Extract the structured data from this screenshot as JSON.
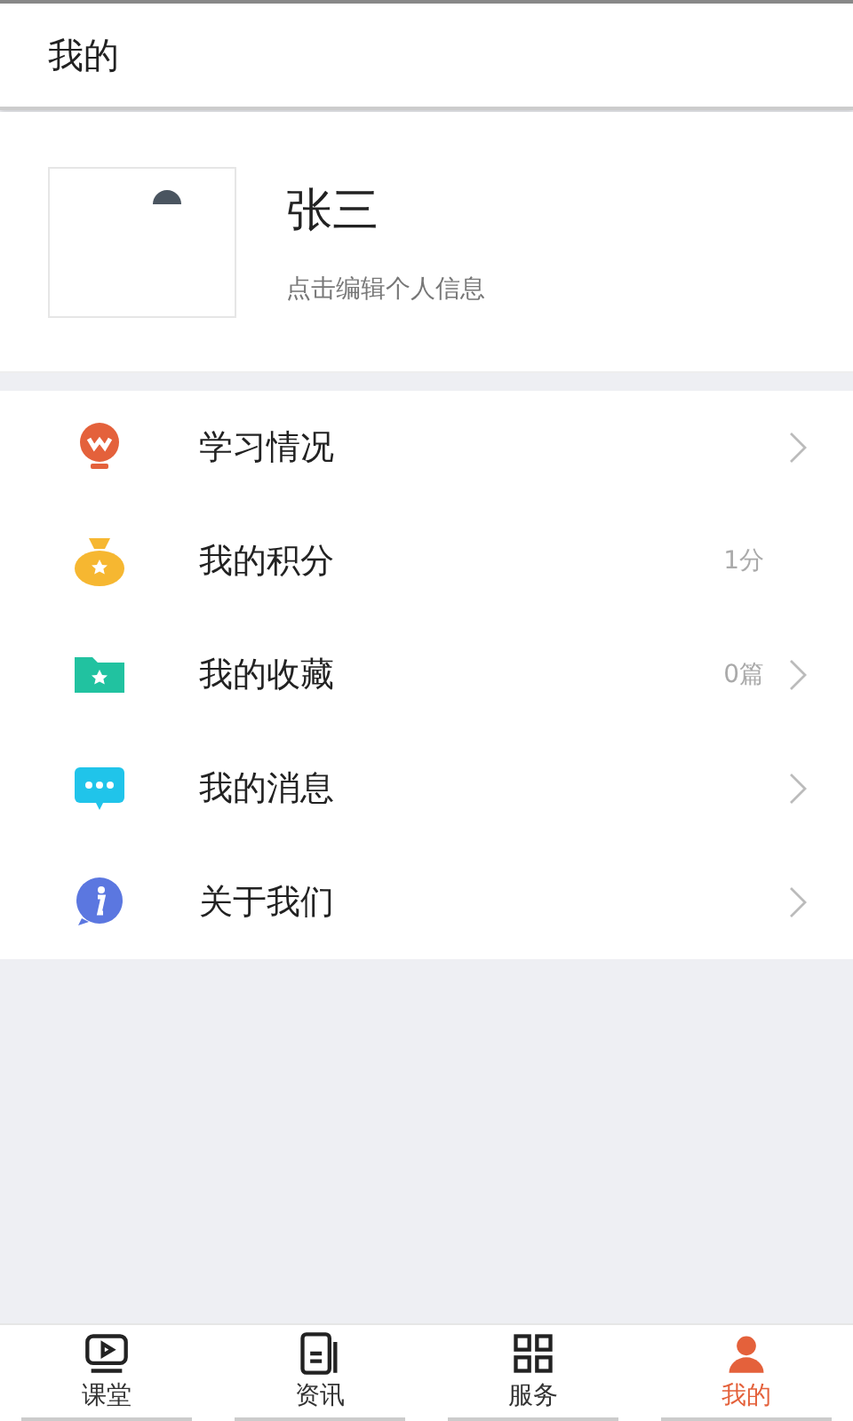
{
  "header": {
    "title": "我的"
  },
  "profile": {
    "name": "张三",
    "hint": "点击编辑个人信息"
  },
  "menu": [
    {
      "kind": "lightbulb",
      "label": "学习情况",
      "arrow": true
    },
    {
      "kind": "moneybag",
      "label": "我的积分",
      "value": "1分",
      "arrow": false
    },
    {
      "kind": "folder",
      "label": "我的收藏",
      "value": "0篇",
      "arrow": true
    },
    {
      "kind": "message",
      "label": "我的消息",
      "arrow": true
    },
    {
      "kind": "info",
      "label": "关于我们",
      "arrow": true
    }
  ],
  "tabs": [
    {
      "kind": "play",
      "label": "课堂",
      "selected": false
    },
    {
      "kind": "news",
      "label": "资讯",
      "selected": false
    },
    {
      "kind": "service",
      "label": "服务",
      "selected": false
    },
    {
      "kind": "user",
      "label": "我的",
      "selected": true
    }
  ]
}
